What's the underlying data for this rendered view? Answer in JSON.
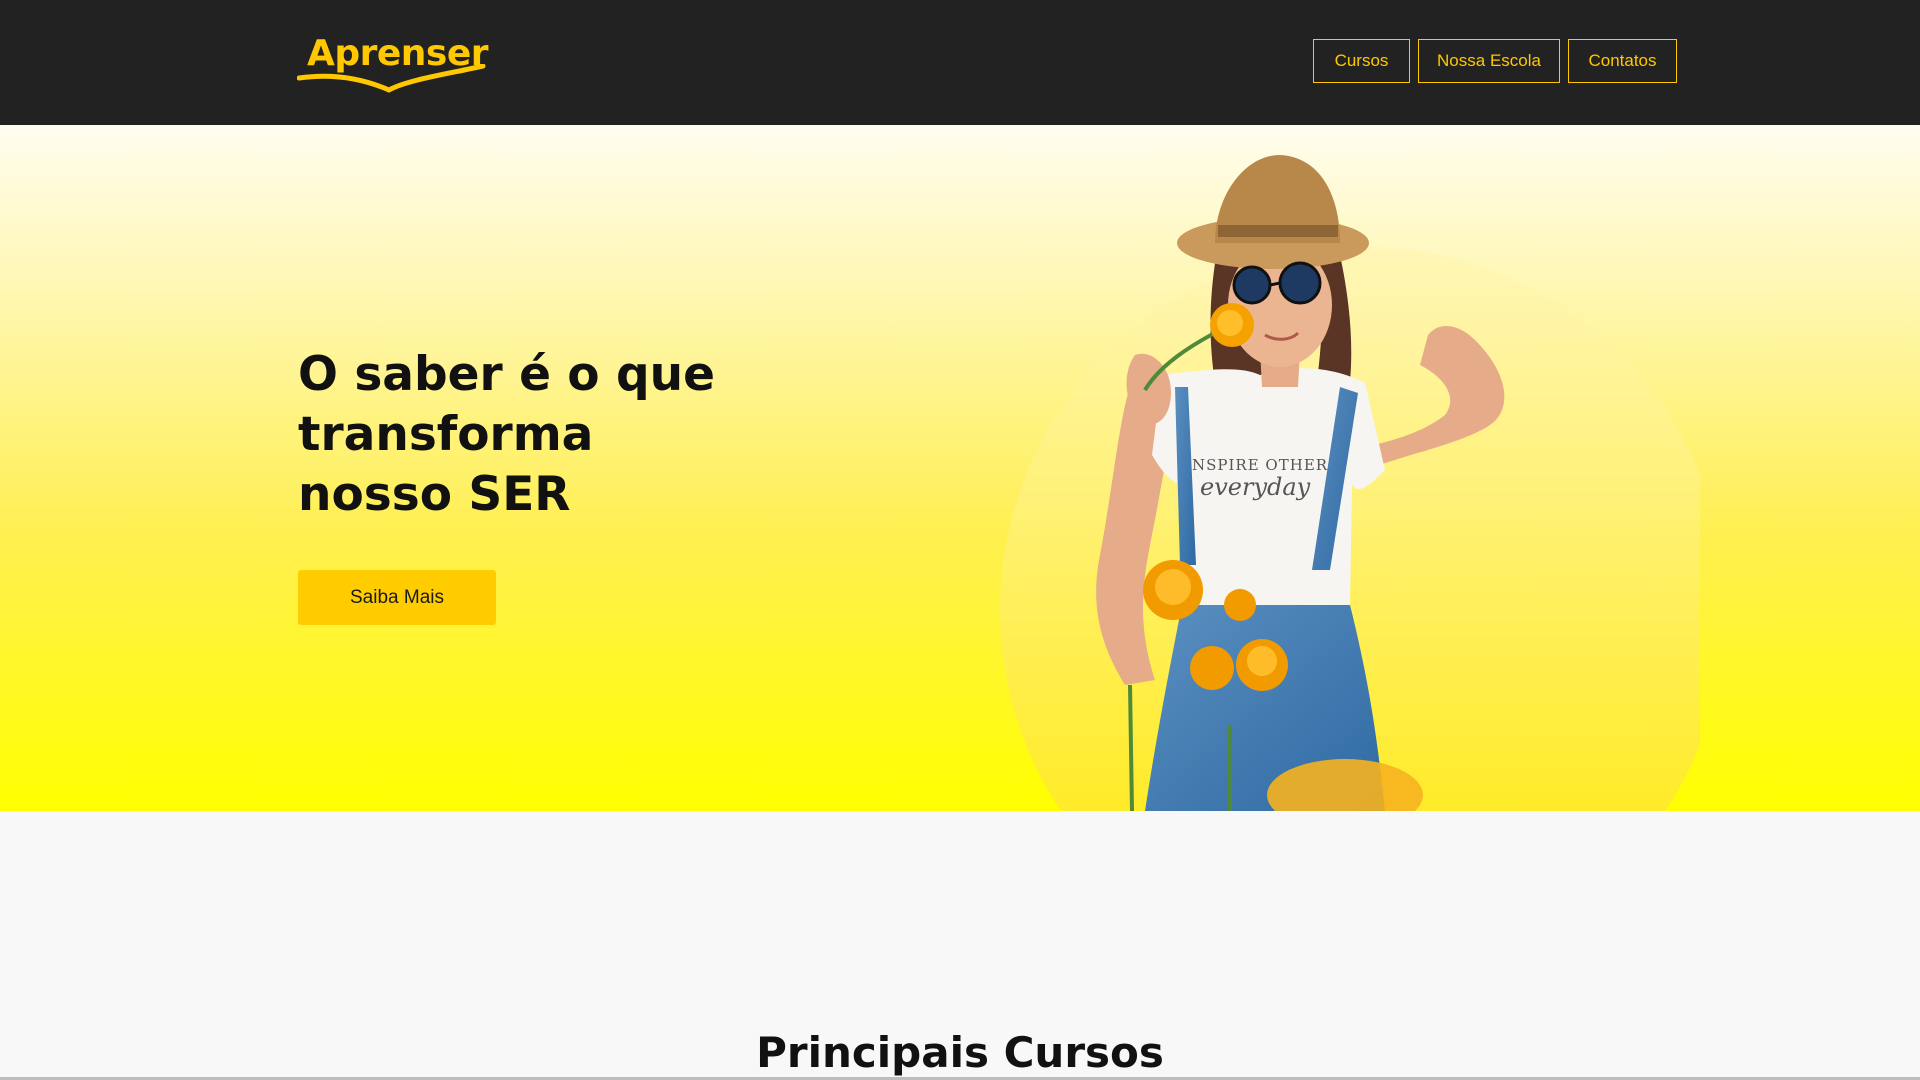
{
  "brand": {
    "name": "Aprenser",
    "accent": "#ffc800",
    "header_bg": "#222222"
  },
  "nav": {
    "items": [
      {
        "label": "Cursos"
      },
      {
        "label": "Nossa Escola"
      },
      {
        "label": "Contatos"
      }
    ]
  },
  "hero": {
    "title_lines": [
      "O saber é o que",
      "transforma",
      "nosso SER"
    ],
    "cta_label": "Saiba Mais",
    "shirt_text_top": "NSPIRE OTHERS",
    "shirt_text_bottom": "everyday"
  },
  "courses": {
    "title": "Principais Cursos"
  }
}
